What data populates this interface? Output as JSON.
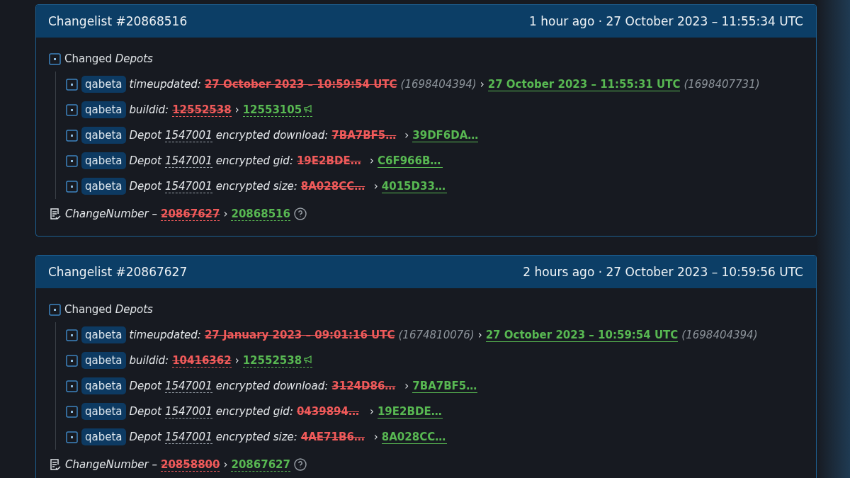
{
  "changelists": [
    {
      "title": "Changelist #20868516",
      "time_info": "1 hour ago · 27 October 2023 – 11:55:34 UTC",
      "group": {
        "label": "Changed *Depots*",
        "rows": [
          {
            "kind": "time",
            "branch": "qabeta",
            "label": "timeupdated:",
            "old": "27 October 2023 – 10:59:54 UTC",
            "old_raw": "(1698404394)",
            "sep": "›",
            "new": "27 October 2023 – 11:55:31 UTC",
            "new_raw": "(1698407731)"
          },
          {
            "kind": "build",
            "branch": "qabeta",
            "label": "buildid:",
            "old": "12552538",
            "sep": "›",
            "new": "12553105"
          },
          {
            "kind": "depot",
            "branch": "qabeta",
            "prefix": "Depot",
            "depot": "1547001",
            "label": "encrypted download:",
            "old": "7BA7BF5…",
            "sep": "›",
            "new": "39DF6DA…"
          },
          {
            "kind": "depot",
            "branch": "qabeta",
            "prefix": "Depot",
            "depot": "1547001",
            "label": "encrypted gid:",
            "old": "19E2BDE…",
            "sep": "›",
            "new": "C6F966B…"
          },
          {
            "kind": "depot",
            "branch": "qabeta",
            "prefix": "Depot",
            "depot": "1547001",
            "label": "encrypted size:",
            "old": "8A028CC…",
            "sep": "›",
            "new": "4015D33…"
          }
        ]
      },
      "change_number": {
        "label": "ChangeNumber –",
        "old": "20867627",
        "sep": "›",
        "new": "20868516"
      }
    },
    {
      "title": "Changelist #20867627",
      "time_info": "2 hours ago · 27 October 2023 – 10:59:56 UTC",
      "group": {
        "label": "Changed *Depots*",
        "rows": [
          {
            "kind": "time",
            "branch": "qabeta",
            "label": "timeupdated:",
            "old": "27 January 2023 – 09:01:16 UTC",
            "old_raw": "(1674810076)",
            "sep": "›",
            "new": "27 October 2023 – 10:59:54 UTC",
            "new_raw": "(1698404394)"
          },
          {
            "kind": "build",
            "branch": "qabeta",
            "label": "buildid:",
            "old": "10416362",
            "sep": "›",
            "new": "12552538"
          },
          {
            "kind": "depot",
            "branch": "qabeta",
            "prefix": "Depot",
            "depot": "1547001",
            "label": "encrypted download:",
            "old": "3124D86…",
            "sep": "›",
            "new": "7BA7BF5…"
          },
          {
            "kind": "depot",
            "branch": "qabeta",
            "prefix": "Depot",
            "depot": "1547001",
            "label": "encrypted gid:",
            "old": "0439894…",
            "sep": "›",
            "new": "19E2BDE…"
          },
          {
            "kind": "depot",
            "branch": "qabeta",
            "prefix": "Depot",
            "depot": "1547001",
            "label": "encrypted size:",
            "old": "4AE71B6…",
            "sep": "›",
            "new": "8A028CC…"
          }
        ]
      },
      "change_number": {
        "label": "ChangeNumber –",
        "old": "20858800",
        "sep": "›",
        "new": "20867627"
      }
    }
  ]
}
